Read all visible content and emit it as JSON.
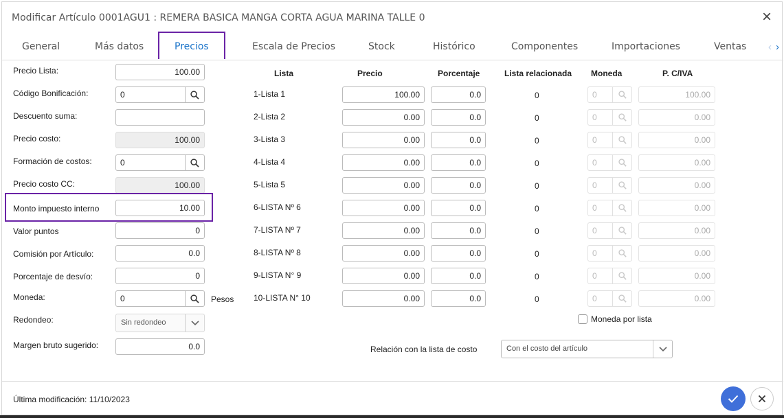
{
  "title": "Modificar Artículo 0001AGU1 : REMERA BASICA MANGA CORTA AGUA MARINA TALLE 0",
  "tabs": [
    "General",
    "Más datos",
    "Precios",
    "Escala de Precios",
    "Stock",
    "Histórico",
    "Componentes",
    "Importaciones",
    "Ventas"
  ],
  "active_tab": "Precios",
  "left": {
    "precio_lista": {
      "label": "Precio Lista:",
      "value": "100.00"
    },
    "codigo_bonificacion": {
      "label": "Código Bonificación:",
      "value": "0"
    },
    "descuento_suma": {
      "label": "Descuento suma:",
      "value": ""
    },
    "precio_costo": {
      "label": "Precio costo:",
      "value": "100.00"
    },
    "formacion_costos": {
      "label": "Formación de costos:",
      "value": "0"
    },
    "precio_costo_cc": {
      "label": "Precio costo CC:",
      "value": "100.00"
    },
    "monto_impuesto": {
      "label": "Monto impuesto interno",
      "value": "10.00"
    },
    "valor_puntos": {
      "label": "Valor puntos",
      "value": "0"
    },
    "comision": {
      "label": "Comisión por Artículo:",
      "value": "0.0"
    },
    "porcentaje_desvio": {
      "label": "Porcentaje de desvío:",
      "value": "0"
    },
    "moneda": {
      "label": "Moneda:",
      "value": "0",
      "suffix": "Pesos"
    },
    "redondeo": {
      "label": "Redondeo:",
      "value": "Sin redondeo"
    },
    "margen_bruto": {
      "label": "Margen bruto sugerido:",
      "value": "0.0"
    }
  },
  "table": {
    "headers": {
      "lista": "Lista",
      "precio": "Precio",
      "porcentaje": "Porcentaje",
      "lista_relacionada": "Lista relacionada",
      "moneda": "Moneda",
      "pciva": "P. C/IVA"
    },
    "rows": [
      {
        "lista": "1-Lista 1",
        "precio": "100.00",
        "porcentaje": "0.0",
        "rel": "0",
        "moneda": "0",
        "pciva": "100.00"
      },
      {
        "lista": "2-Lista 2",
        "precio": "0.00",
        "porcentaje": "0.0",
        "rel": "0",
        "moneda": "0",
        "pciva": "0.00"
      },
      {
        "lista": "3-Lista 3",
        "precio": "0.00",
        "porcentaje": "0.0",
        "rel": "0",
        "moneda": "0",
        "pciva": "0.00"
      },
      {
        "lista": "4-Lista 4",
        "precio": "0.00",
        "porcentaje": "0.0",
        "rel": "0",
        "moneda": "0",
        "pciva": "0.00"
      },
      {
        "lista": "5-Lista 5",
        "precio": "0.00",
        "porcentaje": "0.0",
        "rel": "0",
        "moneda": "0",
        "pciva": "0.00"
      },
      {
        "lista": "6-LISTA Nº 6",
        "precio": "0.00",
        "porcentaje": "0.0",
        "rel": "0",
        "moneda": "0",
        "pciva": "0.00"
      },
      {
        "lista": "7-LISTA Nº 7",
        "precio": "0.00",
        "porcentaje": "0.0",
        "rel": "0",
        "moneda": "0",
        "pciva": "0.00"
      },
      {
        "lista": "8-LISTA Nº 8",
        "precio": "0.00",
        "porcentaje": "0.0",
        "rel": "0",
        "moneda": "0",
        "pciva": "0.00"
      },
      {
        "lista": "9-LISTA N° 9",
        "precio": "0.00",
        "porcentaje": "0.0",
        "rel": "0",
        "moneda": "0",
        "pciva": "0.00"
      },
      {
        "lista": "10-LISTA N° 10",
        "precio": "0.00",
        "porcentaje": "0.0",
        "rel": "0",
        "moneda": "0",
        "pciva": "0.00"
      }
    ]
  },
  "moneda_por_lista": {
    "label": "Moneda por lista",
    "checked": false
  },
  "relacion_costo": {
    "label": "Relación con la lista de costo",
    "value": "Con el costo del artículo"
  },
  "footer": {
    "last_modified": "Última modificación: 11/10/2023"
  },
  "colors": {
    "accent": "#1a73c9",
    "highlight": "#6a23a6",
    "confirm": "#3f6fd9"
  },
  "icons": {
    "close": "close-icon",
    "search": "search-icon",
    "chevron": "chevron-down-icon",
    "check": "check-icon"
  }
}
